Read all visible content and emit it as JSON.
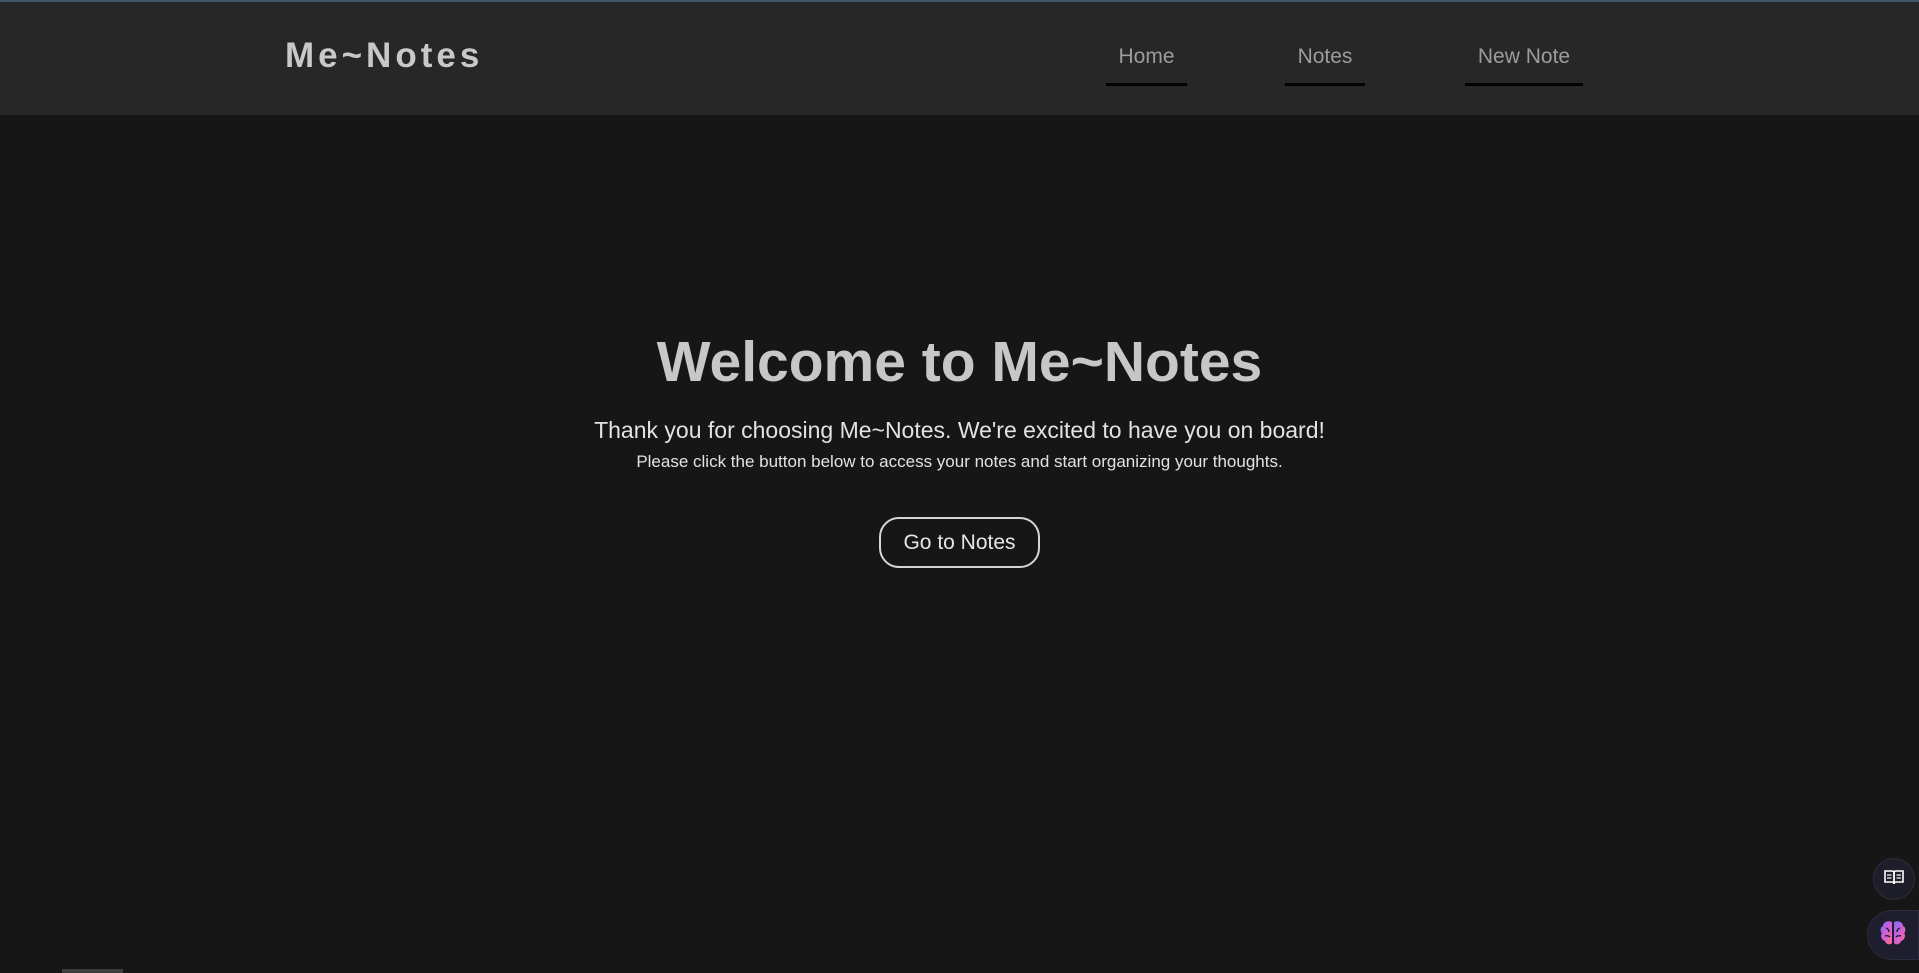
{
  "brand": "Me~Notes",
  "nav": {
    "home": "Home",
    "notes": "Notes",
    "new_note": "New Note"
  },
  "hero": {
    "title": "Welcome to Me~Notes",
    "subtitle": "Thank you for choosing Me~Notes. We're excited to have you on board!",
    "note": "Please click the button below to access your notes and start organizing your thoughts.",
    "cta": "Go to Notes"
  },
  "icons": {
    "reader": "book-open-icon",
    "assistant": "brain-icon"
  },
  "colors": {
    "background": "#161616",
    "navbar": "#272727",
    "accent": "#3d5566"
  }
}
